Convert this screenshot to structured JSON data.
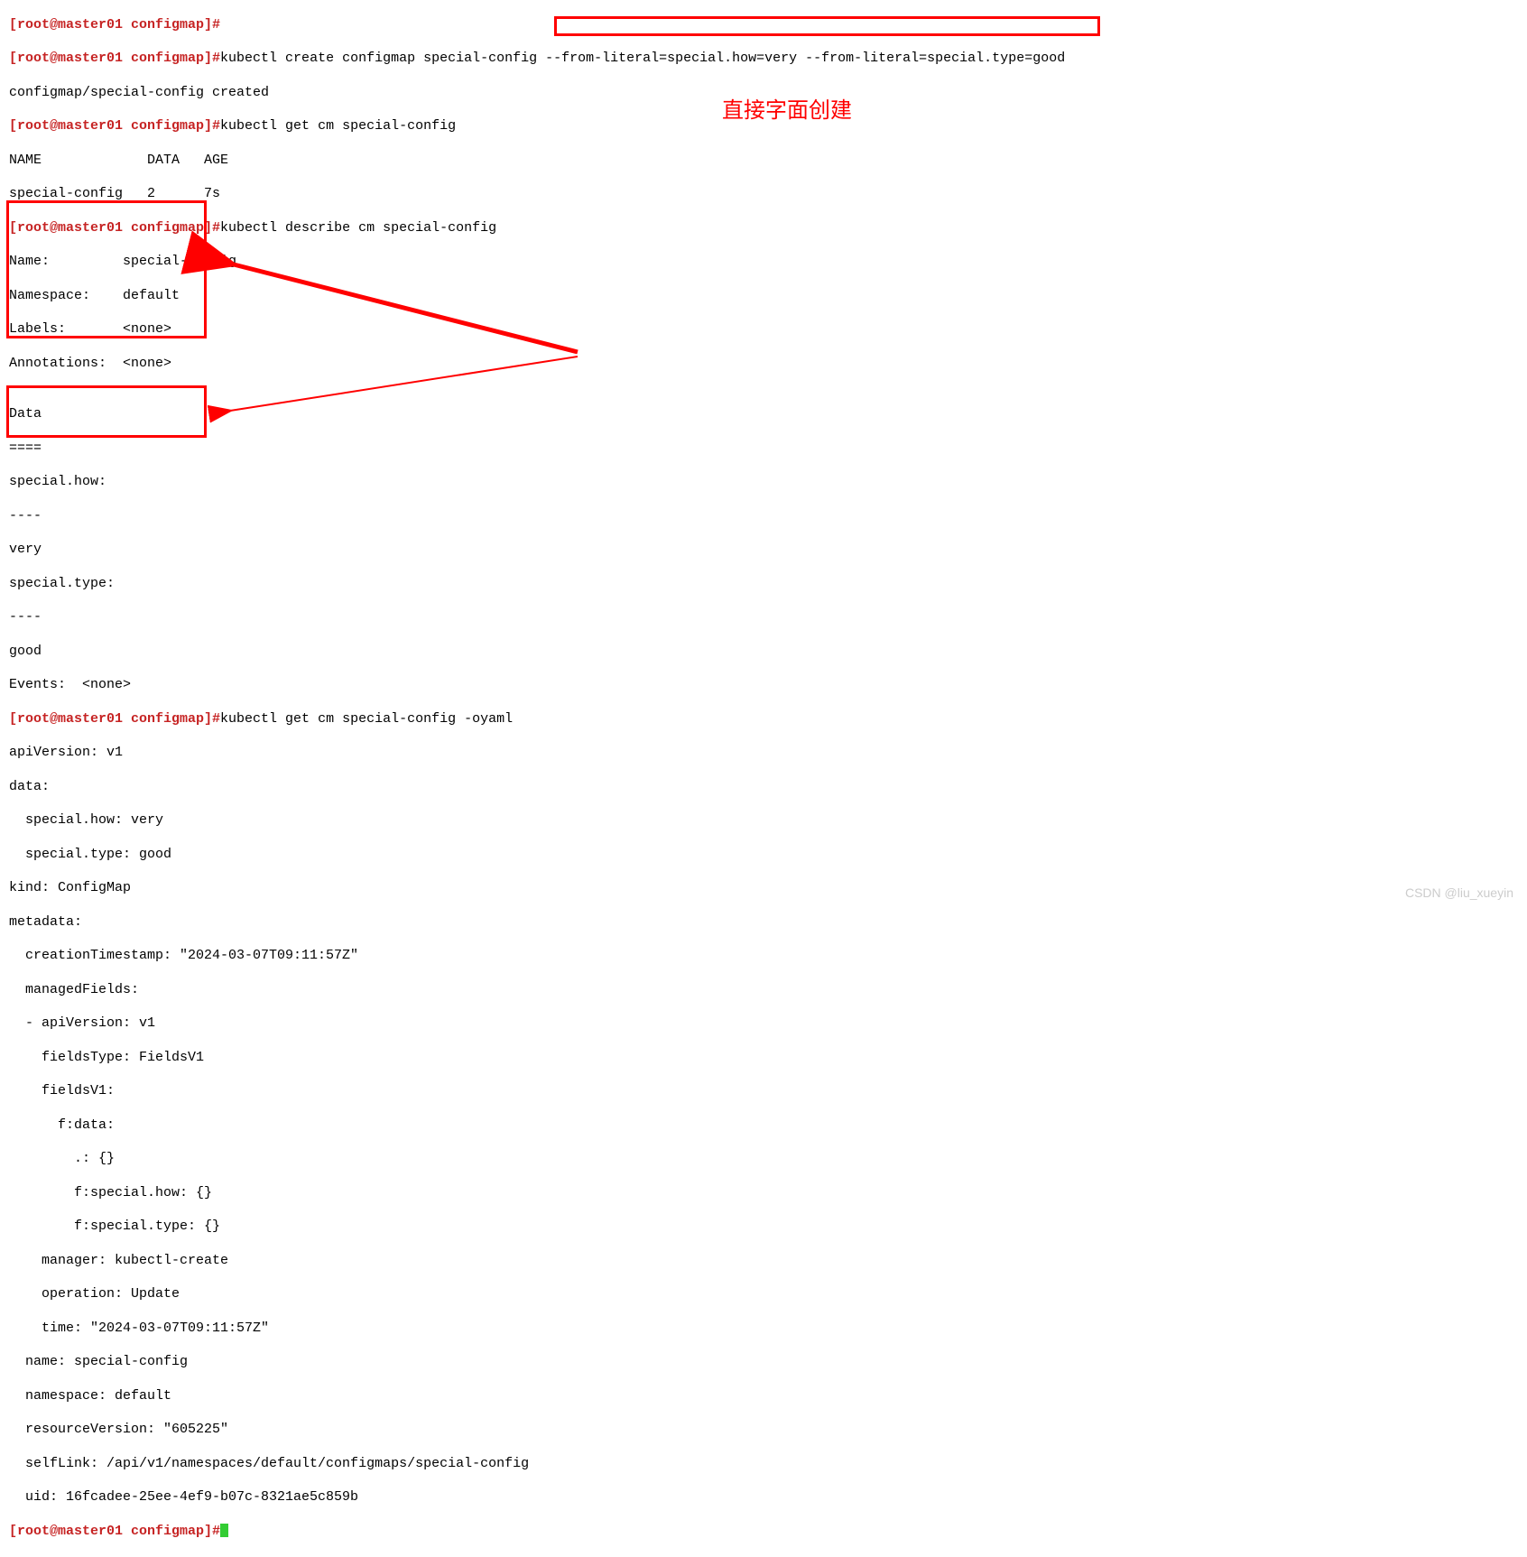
{
  "line0_prompt": "[root@master01 configmap]#",
  "line1_prompt": "[root@master01 configmap]#",
  "line1_cmd": "kubectl create configmap special-config --from-literal=special.how=very --from-literal=special.type=good",
  "line2": "configmap/special-config created",
  "line3_prompt": "[root@master01 configmap]#",
  "line3_cmd": "kubectl get cm special-config",
  "line4": "NAME             DATA   AGE",
  "line5": "special-config   2      7s",
  "line6_prompt": "[root@master01 configmap]#",
  "line6_cmd": "kubectl describe cm special-config",
  "line7": "Name:         special-config",
  "line8": "Namespace:    default",
  "line9": "Labels:       <none>",
  "line10": "Annotations:  <none>",
  "line11": "",
  "line12": "Data",
  "line13": "====",
  "line14": "special.how:",
  "line15": "----",
  "line16": "very",
  "line17": "special.type:",
  "line18": "----",
  "line19": "good",
  "line20": "Events:  <none>",
  "line21_prompt": "[root@master01 configmap]#",
  "line21_cmd": "kubectl get cm special-config -oyaml",
  "line22": "apiVersion: v1",
  "line23": "data:",
  "line24": "  special.how: very",
  "line25": "  special.type: good",
  "line26": "kind: ConfigMap",
  "line27": "metadata:",
  "line28": "  creationTimestamp: \"2024-03-07T09:11:57Z\"",
  "line29": "  managedFields:",
  "line30": "  - apiVersion: v1",
  "line31": "    fieldsType: FieldsV1",
  "line32": "    fieldsV1:",
  "line33": "      f:data:",
  "line34": "        .: {}",
  "line35": "        f:special.how: {}",
  "line36": "        f:special.type: {}",
  "line37": "    manager: kubectl-create",
  "line38": "    operation: Update",
  "line39": "    time: \"2024-03-07T09:11:57Z\"",
  "line40": "  name: special-config",
  "line41": "  namespace: default",
  "line42": "  resourceVersion: \"605225\"",
  "line43": "  selfLink: /api/v1/namespaces/default/configmaps/special-config",
  "line44": "  uid: 16fcadee-25ee-4ef9-b07c-8321ae5c859b",
  "line45_prompt": "[root@master01 configmap]#",
  "annotation_text": "直接字面创建",
  "watermark": "CSDN @liu_xueyin"
}
